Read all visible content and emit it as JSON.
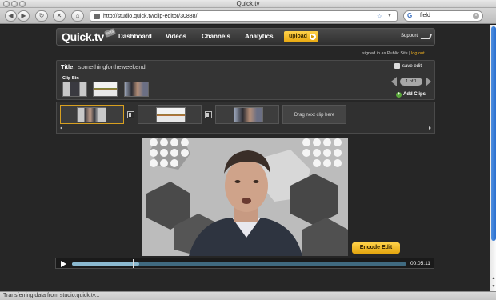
{
  "window": {
    "title": "Quick.tv"
  },
  "browser": {
    "url": "http://studio.quick.tv/clip-editor/30888/",
    "search_value": "field",
    "status": "Transferring data from studio.quick.tv..."
  },
  "site": {
    "logo": "Quick.tv",
    "badge": "beta",
    "nav": [
      "Dashboard",
      "Videos",
      "Channels",
      "Analytics"
    ],
    "upload_label": "upload",
    "support_label": "Support",
    "signed_in_prefix": "signed in as",
    "user_name": "Public Sits",
    "separator": "|",
    "logout_label": "log out"
  },
  "editor": {
    "title_label": "Title:",
    "title_value": "somethingfortheweekend",
    "save_label": "save edit",
    "clip_bin_label": "Clip Bin",
    "pager_label": "1 of 1",
    "add_clips_label": "Add Clips",
    "drop_slot_label": "Drag next clip here",
    "encode_label": "Encode Edit",
    "time": "00:05:11",
    "progress": 0.2
  },
  "colors": {
    "accent": "#f0b020",
    "page_bg": "#262626"
  }
}
